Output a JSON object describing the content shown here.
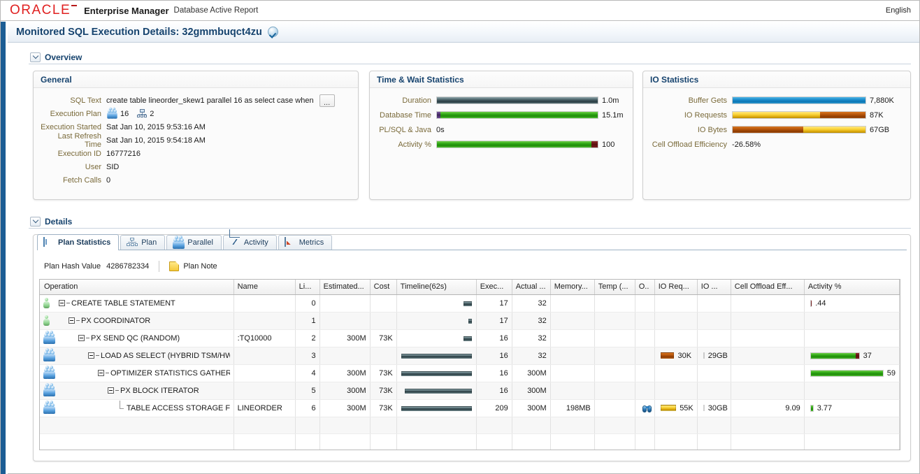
{
  "brand": {
    "logo": "ORACLE",
    "app_title": "Enterprise Manager",
    "app_subtitle": "Database Active Report",
    "language": "English"
  },
  "page_header": {
    "title": "Monitored SQL Execution Details: 32gmmbuqct4zu",
    "status_icon": "check-circle-icon"
  },
  "overview": {
    "section_title": "Overview",
    "general": {
      "panel_title": "General",
      "rows": [
        {
          "label": "SQL Text",
          "value": "create table lineorder_skew1 parallel 16 as select case when",
          "more_button": "..."
        },
        {
          "label": "Execution Plan",
          "value_parallel": "16",
          "value_plan": "2"
        },
        {
          "label": "Execution Started",
          "value": "Sat Jan 10, 2015 9:53:16 AM"
        },
        {
          "label": "Last Refresh Time",
          "value": "Sat Jan 10, 2015 9:54:18 AM"
        },
        {
          "label": "Execution ID",
          "value": "16777216"
        },
        {
          "label": "User",
          "value": "SID"
        },
        {
          "label": "Fetch Calls",
          "value": "0"
        }
      ]
    },
    "time_wait": {
      "panel_title": "Time & Wait Statistics",
      "rows": [
        {
          "label": "Duration",
          "value": "1.0m",
          "type": "bar",
          "segments": [
            {
              "color": "#3b5257",
              "pct": 100
            }
          ]
        },
        {
          "label": "Database Time",
          "value": "15.1m",
          "type": "bar",
          "segments": [
            {
              "color": "#3d2559",
              "pct": 2
            },
            {
              "color": "#2da513",
              "pct": 98
            }
          ]
        },
        {
          "label": "PL/SQL & Java",
          "value": "0s",
          "type": "text"
        },
        {
          "label": "Activity %",
          "value": "100",
          "type": "bar",
          "segments": [
            {
              "color": "#2da513",
              "pct": 96
            },
            {
              "color": "#5b0f0f",
              "pct": 4
            }
          ]
        }
      ]
    },
    "io": {
      "panel_title": "IO Statistics",
      "rows": [
        {
          "label": "Buffer Gets",
          "value": "7,880K",
          "type": "bar",
          "segments": [
            {
              "color": "#1688c8",
              "pct": 100
            }
          ]
        },
        {
          "label": "IO Requests",
          "value": "87K",
          "type": "bar",
          "segments": [
            {
              "color": "#fbd53b",
              "pct": 66
            },
            {
              "color": "#b45309",
              "pct": 34
            }
          ]
        },
        {
          "label": "IO Bytes",
          "value": "67GB",
          "type": "bar",
          "segments": [
            {
              "color": "#b45309",
              "pct": 53
            },
            {
              "color": "#fbd53b",
              "pct": 47
            }
          ]
        },
        {
          "label": "Cell Offload Efficiency",
          "value": "-26.58%",
          "type": "text"
        }
      ]
    }
  },
  "details": {
    "section_title": "Details",
    "tabs": [
      {
        "label": "Plan Statistics",
        "icon": "plan-statistics-icon",
        "active": true
      },
      {
        "label": "Plan",
        "icon": "plan-tree-icon",
        "active": false
      },
      {
        "label": "Parallel",
        "icon": "parallel-group-icon",
        "active": false
      },
      {
        "label": "Activity",
        "icon": "activity-chart-icon",
        "active": false
      },
      {
        "label": "Metrics",
        "icon": "metrics-chart-icon",
        "active": false
      }
    ],
    "toolbar": {
      "plan_hash_label": "Plan Hash Value",
      "plan_hash_value": "4286782334",
      "plan_note_label": "Plan Note",
      "plan_note_icon": "note-icon"
    },
    "table": {
      "columns": [
        "Operation",
        "Name",
        "Li...",
        "Estimated...",
        "Cost",
        "Timeline(62s)",
        "Exec...",
        "Actual ...",
        "Memory...",
        "Temp (...",
        "O..",
        "IO Req...",
        "IO ...",
        "Cell Offload Eff...",
        "Activity %"
      ],
      "rows": [
        {
          "icon": "serial-person-icon",
          "indent": 0,
          "node": "expander",
          "operation": "CREATE TABLE STATEMENT",
          "name": "",
          "line": "0",
          "estimated": "",
          "cost": "",
          "timeline": {
            "start_pct": 88,
            "width_pct": 11
          },
          "exec": "17",
          "actual": "32",
          "memory": "",
          "temp": "",
          "offload_icon": "",
          "io_req": null,
          "io_bytes": null,
          "cell_offload": "",
          "activity": {
            "value": ".44",
            "segments": [
              {
                "color": "#5b0f0f",
                "pct": 100
              }
            ],
            "width_pct": 2
          }
        },
        {
          "icon": "serial-person-icon",
          "indent": 1,
          "node": "expander",
          "operation": "PX COORDINATOR",
          "name": "",
          "line": "1",
          "estimated": "",
          "cost": "",
          "timeline": {
            "start_pct": 94,
            "width_pct": 5
          },
          "exec": "17",
          "actual": "32",
          "memory": "",
          "temp": "",
          "offload_icon": "",
          "io_req": null,
          "io_bytes": null,
          "cell_offload": "",
          "activity": null
        },
        {
          "icon": "parallel-group-icon",
          "indent": 2,
          "node": "expander",
          "operation": "PX SEND QC (RANDOM)",
          "name": ":TQ10000",
          "line": "2",
          "estimated": "300M",
          "cost": "73K",
          "timeline": {
            "start_pct": 88,
            "width_pct": 11
          },
          "exec": "16",
          "actual": "32",
          "memory": "",
          "temp": "",
          "offload_icon": "",
          "io_req": null,
          "io_bytes": null,
          "cell_offload": "",
          "activity": null
        },
        {
          "icon": "parallel-group-icon",
          "indent": 3,
          "node": "expander",
          "operation": "LOAD AS SELECT (HYBRID TSM/HW...",
          "name": "",
          "line": "3",
          "estimated": "",
          "cost": "",
          "timeline": {
            "start_pct": 1,
            "width_pct": 98
          },
          "exec": "16",
          "actual": "32",
          "memory": "",
          "temp": "",
          "offload_icon": "",
          "io_req": {
            "value": "30K",
            "color": "#b45309",
            "width_pct": 42
          },
          "io_bytes": {
            "value": "29GB",
            "color": "#b45309",
            "width_pct": 13
          },
          "cell_offload": "",
          "activity": {
            "value": "37",
            "segments": [
              {
                "color": "#2da513",
                "pct": 93
              },
              {
                "color": "#5b0f0f",
                "pct": 7
              }
            ],
            "width_pct": 58
          }
        },
        {
          "icon": "parallel-group-icon",
          "indent": 4,
          "node": "expander",
          "operation": "OPTIMIZER STATISTICS GATHERI...",
          "name": "",
          "line": "4",
          "estimated": "300M",
          "cost": "73K",
          "timeline": {
            "start_pct": 1,
            "width_pct": 98
          },
          "exec": "16",
          "actual": "300M",
          "memory": "",
          "temp": "",
          "offload_icon": "",
          "io_req": null,
          "io_bytes": null,
          "cell_offload": "",
          "activity": {
            "value": "59",
            "segments": [
              {
                "color": "#2da513",
                "pct": 100
              }
            ],
            "width_pct": 88
          }
        },
        {
          "icon": "parallel-group-icon",
          "indent": 5,
          "node": "expander",
          "operation": "PX BLOCK ITERATOR",
          "name": "",
          "line": "5",
          "estimated": "300M",
          "cost": "73K",
          "timeline": {
            "start_pct": 6,
            "width_pct": 93
          },
          "exec": "16",
          "actual": "300M",
          "memory": "",
          "temp": "",
          "offload_icon": "",
          "io_req": null,
          "io_bytes": null,
          "cell_offload": "",
          "activity": null
        },
        {
          "icon": "parallel-group-icon",
          "indent": 6,
          "node": "leaf",
          "operation": "TABLE ACCESS STORAGE FULL",
          "name": "LINEORDER",
          "line": "6",
          "estimated": "300M",
          "cost": "73K",
          "timeline": {
            "start_pct": 1,
            "width_pct": 98
          },
          "exec": "209",
          "actual": "300M",
          "memory": "198MB",
          "temp": "",
          "offload_icon": "binoculars-icon",
          "io_req": {
            "value": "55K",
            "color": "#fbd53b",
            "width_pct": 60
          },
          "io_bytes": {
            "value": "30GB",
            "color": "#fbd53b",
            "width_pct": 13
          },
          "cell_offload": "9.09",
          "activity": {
            "value": "3.77",
            "segments": [
              {
                "color": "#2da513",
                "pct": 100
              }
            ],
            "width_pct": 4
          }
        }
      ]
    }
  }
}
